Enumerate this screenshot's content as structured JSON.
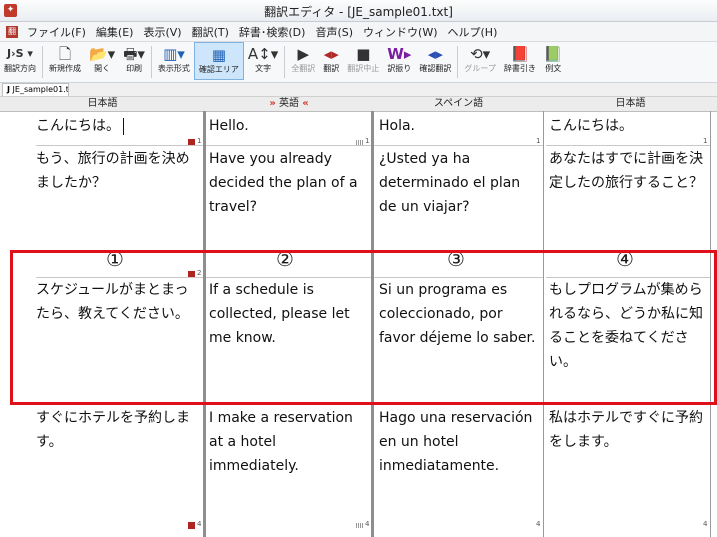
{
  "window": {
    "title": "翻訳エディタ - [JE_sample01.txt]",
    "app_icon": "translate-app-icon"
  },
  "menu": {
    "items": [
      "ファイル(F)",
      "編集(E)",
      "表示(V)",
      "翻訳(T)",
      "辞書･検索(D)",
      "音声(S)",
      "ウィンドウ(W)",
      "ヘルプ(H)"
    ]
  },
  "toolbar": {
    "items": [
      {
        "icon": "J›S ▾",
        "label": "翻訳方向"
      },
      {
        "icon": "🗋",
        "label": "新規作成"
      },
      {
        "icon": "📂▾",
        "label": "開く"
      },
      {
        "icon": "🖶▾",
        "label": "印刷"
      },
      {
        "icon": "▥▾",
        "label": "表示形式"
      },
      {
        "icon": "▦",
        "label": "確認エリア"
      },
      {
        "icon": "A↕▾",
        "label": "文字"
      },
      {
        "icon": "▶",
        "label": "全翻訳"
      },
      {
        "icon": "◂▸",
        "label": "翻訳"
      },
      {
        "icon": "■",
        "label": "翻訳中止"
      },
      {
        "icon": "W▸",
        "label": "訳振り"
      },
      {
        "icon": "◂▸",
        "label": "確認翻訳"
      },
      {
        "icon": "⟲▾",
        "label": "グループ"
      },
      {
        "icon": "📕",
        "label": "辞書引き"
      },
      {
        "icon": "📗",
        "label": "例文"
      }
    ]
  },
  "document_tab": "JE_sample01.t",
  "columns": [
    {
      "label": "日本語"
    },
    {
      "label": "英語",
      "prefix": "»",
      "suffix": "«"
    },
    {
      "label": "スペイン語"
    },
    {
      "label": "日本語"
    }
  ],
  "rows": [
    {
      "num": "1",
      "cells": [
        "こんにちは。",
        "Hello.",
        "Hola.",
        "こんにちは。"
      ]
    },
    {
      "num": "1",
      "cells": [
        "もう、旅行の計画を決めましたか？",
        "Have you already decided the plan of a travel?",
        "¿Usted ya ha determinado el plan de un viajar?",
        "あなたはすでに計画を決定したの旅行すること？"
      ]
    },
    {
      "num": "2",
      "cells": [
        "スケジュールがまとまったら、教えてください。",
        "If a schedule is collected, please let me know.",
        "Si un programa es coleccionado, por favor déjeme lo saber.",
        "もしプログラムが集められるなら、どうか私に知ることを委ねてください。"
      ]
    },
    {
      "num": "4",
      "cells": [
        "すぐにホテルを予約します。",
        "I make a reservation at a hotel immediately.",
        "Hago una reservación en un hotel inmediatamente.",
        "私はホテルですぐに予約をします。"
      ]
    }
  ],
  "callouts": [
    "①",
    "②",
    "③",
    "④"
  ]
}
